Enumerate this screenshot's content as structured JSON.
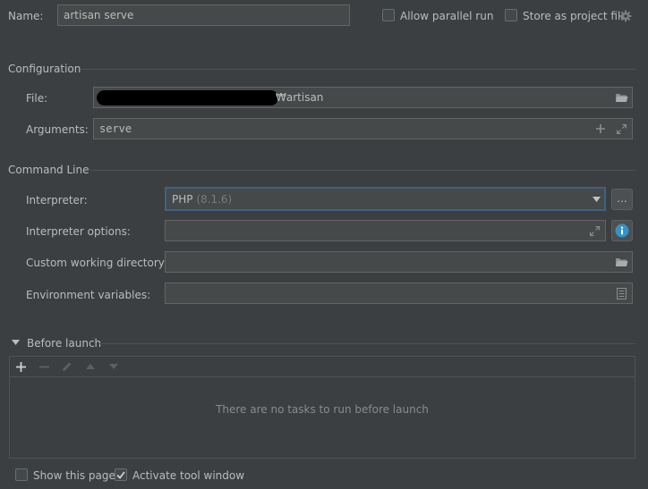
{
  "name_row": {
    "label": "Name:",
    "value": "artisan serve",
    "allow_parallel_label": "Allow parallel run",
    "store_project_label": "Store as project file"
  },
  "configuration": {
    "title": "Configuration",
    "file_label": "File:",
    "file_value": "₩artisan",
    "arguments_label": "Arguments:",
    "arguments_value": "serve"
  },
  "command_line": {
    "title": "Command Line",
    "interpreter_label": "Interpreter:",
    "interpreter_name": "PHP",
    "interpreter_version": "(8.1.6)",
    "browse_label": "...",
    "interpreter_options_label": "Interpreter options:",
    "working_dir_label": "Custom working directory:",
    "env_vars_label": "Environment variables:"
  },
  "before_launch": {
    "title": "Before launch",
    "empty_text": "There are no tasks to run before launch"
  },
  "footer": {
    "show_page_label": "Show this page",
    "activate_tool_label": "Activate tool window"
  },
  "colors": {
    "background": "#3c3f41",
    "field": "#45494a",
    "focus_border": "#3d6185",
    "info_blue": "#3592c4"
  },
  "checkbox_state": {
    "allow_parallel": false,
    "store_project": false,
    "show_page": false,
    "activate_tool": true
  },
  "icons": [
    "gear-icon",
    "folder-icon",
    "plus-icon",
    "expand-icon",
    "dropdown-arrow-icon",
    "info-icon",
    "document-icon",
    "minus-icon",
    "edit-icon",
    "arrow-up-icon",
    "arrow-down-icon",
    "collapse-triangle-icon",
    "checkmark-icon"
  ]
}
